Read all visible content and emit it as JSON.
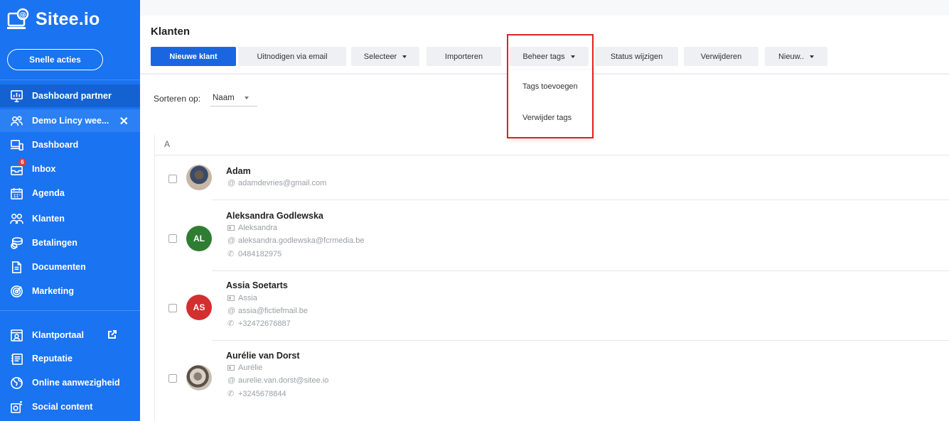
{
  "app": {
    "logo_text": "Sitee.io",
    "brand_color": "#1a73f0"
  },
  "sidebar": {
    "quick_actions": "Snelle acties",
    "items": [
      {
        "label": "Dashboard partner",
        "icon": "monitor-chart-icon"
      },
      {
        "label": "Demo Lincy wee...",
        "icon": "users-icon"
      },
      {
        "label": "Dashboard",
        "icon": "devices-icon"
      },
      {
        "label": "Inbox",
        "icon": "inbox-icon",
        "badge": "6"
      },
      {
        "label": "Agenda",
        "icon": "calendar-icon"
      },
      {
        "label": "Klanten",
        "icon": "customers-icon"
      },
      {
        "label": "Betalingen",
        "icon": "coins-icon"
      },
      {
        "label": "Documenten",
        "icon": "document-icon"
      },
      {
        "label": "Marketing",
        "icon": "target-icon"
      },
      {
        "label": "Klantportaal",
        "icon": "portal-icon"
      },
      {
        "label": "Reputatie",
        "icon": "review-icon"
      },
      {
        "label": "Online aanwezigheid",
        "icon": "globe-icon"
      },
      {
        "label": "Social content",
        "icon": "social-icon"
      }
    ],
    "close_symbol": "✕"
  },
  "page": {
    "title": "Klanten"
  },
  "toolbar": {
    "new_client": "Nieuwe klant",
    "invite_email": "Uitnodigen via email",
    "select": "Selecteer",
    "import": "Importeren",
    "manage_tags": "Beheer tags",
    "change_status": "Status wijzigen",
    "delete": "Verwijderen",
    "new": "Nieuw.."
  },
  "dropdown": {
    "add_tags": "Tags toevoegen",
    "remove_tags": "Verwijder tags"
  },
  "sort": {
    "label": "Sorteren op:",
    "value": "Naam"
  },
  "list": {
    "section_letter": "A",
    "clients": [
      {
        "name": "Adam",
        "email": "adamdevries@gmail.com",
        "avatar": "photo"
      },
      {
        "name": "Aleksandra Godlewska",
        "first_name": "Aleksandra",
        "email": "aleksandra.godlewska@fcrmedia.be",
        "phone": "0484182975",
        "initials": "AL"
      },
      {
        "name": "Assia Soetarts",
        "first_name": "Assia",
        "email": "assia@fictiefmail.be",
        "phone": "+32472676887",
        "initials": "AS"
      },
      {
        "name": "Aurélie van Dorst",
        "first_name": "Aurélie",
        "email": "aurelie.van.dorst@sitee.io",
        "phone": "+3245678844",
        "avatar": "photo"
      }
    ]
  }
}
